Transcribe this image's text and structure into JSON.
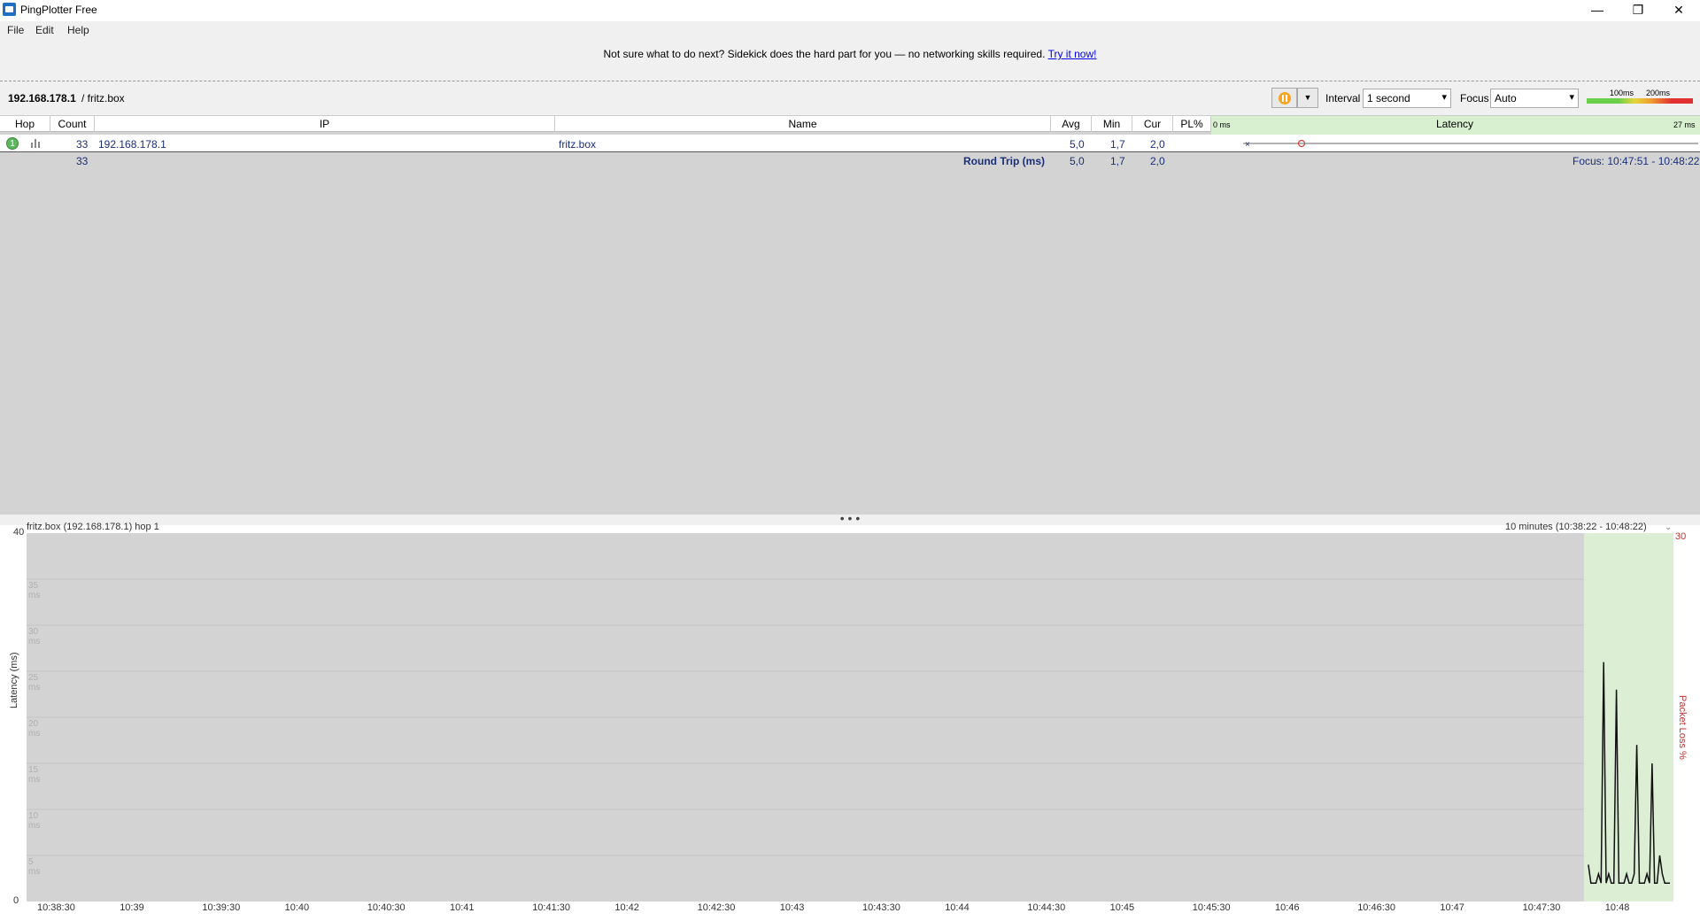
{
  "window": {
    "title": "PingPlotter Free",
    "minimize": "—",
    "maximize": "❐",
    "close": "✕"
  },
  "menu": [
    "File",
    "Edit",
    "Help"
  ],
  "banner": {
    "text": "Not sure what to do next? Sidekick does the hard part for you — no networking skills required.",
    "link": "Try it now!"
  },
  "target": {
    "ip": "192.168.178.1",
    "host": "/ fritz.box"
  },
  "toolbar": {
    "interval_label": "Interval",
    "interval_value": "1 second",
    "focus_label": "Focus",
    "focus_value": "Auto",
    "legend_100": "100ms",
    "legend_200": "200ms"
  },
  "columns": {
    "hop": "Hop",
    "count": "Count",
    "ip": "IP",
    "name": "Name",
    "avg": "Avg",
    "min": "Min",
    "cur": "Cur",
    "pl": "PL%",
    "latency": "Latency",
    "lat_min": "0 ms",
    "lat_max": "27 ms"
  },
  "rows": [
    {
      "hop": "1",
      "count": "33",
      "ip": "192.168.178.1",
      "name": "fritz.box",
      "avg": "5,0",
      "min": "1,7",
      "cur": "2,0",
      "pl": ""
    }
  ],
  "round_trip": {
    "count": "33",
    "label": "Round Trip (ms)",
    "avg": "5,0",
    "min": "1,7",
    "cur": "2,0",
    "focus": "Focus: 10:47:51 - 10:48:22"
  },
  "chart_header": {
    "title": "fritz.box (192.168.178.1) hop 1",
    "range": "10 minutes (10:38:22 - 10:48:22)"
  },
  "splitter": "• • •",
  "chart_data": {
    "type": "line",
    "ylabel": "Latency (ms)",
    "y2label": "Packet Loss %",
    "ylim": [
      0,
      40
    ],
    "y2_top": "30",
    "y_ticks": [
      "40",
      "35 ms",
      "30 ms",
      "25 ms",
      "20 ms",
      "15 ms",
      "10 ms",
      "5 ms",
      "0"
    ],
    "x_ticks": [
      "10:38:30",
      "10:39",
      "10:39:30",
      "10:40",
      "10:40:30",
      "10:41",
      "10:41:30",
      "10:42",
      "10:42:30",
      "10:43",
      "10:43:30",
      "10:44",
      "10:44:30",
      "10:45",
      "10:45:30",
      "10:46",
      "10:46:30",
      "10:47",
      "10:47:30",
      "10:48"
    ],
    "series": [
      {
        "values": [
          4,
          2,
          2,
          2,
          3,
          2,
          26,
          2,
          3,
          2,
          2,
          23,
          2,
          2,
          2,
          3,
          2,
          2,
          3,
          17,
          2,
          2,
          2,
          3,
          2,
          15,
          2,
          2,
          5,
          3,
          2,
          2,
          2
        ]
      }
    ],
    "focus_start": "10:47:51",
    "focus_end": "10:48:22"
  }
}
